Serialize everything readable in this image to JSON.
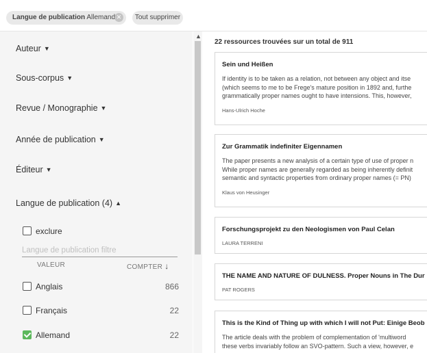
{
  "filters": {
    "chip_label": "Langue de publication",
    "chip_value": "Allemand",
    "clear_all": "Tout supprimer"
  },
  "sidebar": {
    "facets": [
      "Auteur",
      "Sous-corpus",
      "Revue / Monographie",
      "Année de publication",
      "Éditeur"
    ],
    "language_facet": "Langue de publication (4)",
    "exclude_label": "exclure",
    "filter_placeholder": "Langue de publication filtre",
    "col_value": "VALEUR",
    "col_count": "COMPTER",
    "languages": [
      {
        "label": "Anglais",
        "count": "866",
        "checked": false
      },
      {
        "label": "Français",
        "count": "22",
        "checked": false
      },
      {
        "label": "Allemand",
        "count": "22",
        "checked": true
      }
    ]
  },
  "results": {
    "summary": "22 ressources trouvées sur un total de 911",
    "items": [
      {
        "title": "Sein und Heißen",
        "abstract": "If identity is to be taken as a relation, not between any object and itse\n(which seems to me to be Frege's mature position in 1892 and, furthe\ngrammatically proper names ought to have intensions. This, however,",
        "author": "Hans-Ulrich Hoche"
      },
      {
        "title": "Zur Grammatik indefiniter Eigennamen",
        "abstract": "The paper presents a new analysis of a certain type of use of proper n\nWhile proper names are generally regarded as being inherently definit\nsemantic and syntactic properties from ordinary proper names (= PN)",
        "author": "Klaus von Heusinger"
      },
      {
        "title": "Forschungsprojekt zu den Neologismen von Paul Celan",
        "abstract": "",
        "author": "LAURA TERRENI"
      },
      {
        "title": "THE NAME AND NATURE OF DULNESS. Proper Nouns in The Dur",
        "abstract": "",
        "author": "PAT ROGERS"
      },
      {
        "title": "This is the Kind of Thing up with which I will not Put: Einige Beob",
        "abstract": "The article deals with the problem of complementation of 'multiword\nthese verbs invariably follow an SVO-pattern. Such a view, however, e",
        "author": ""
      }
    ]
  }
}
